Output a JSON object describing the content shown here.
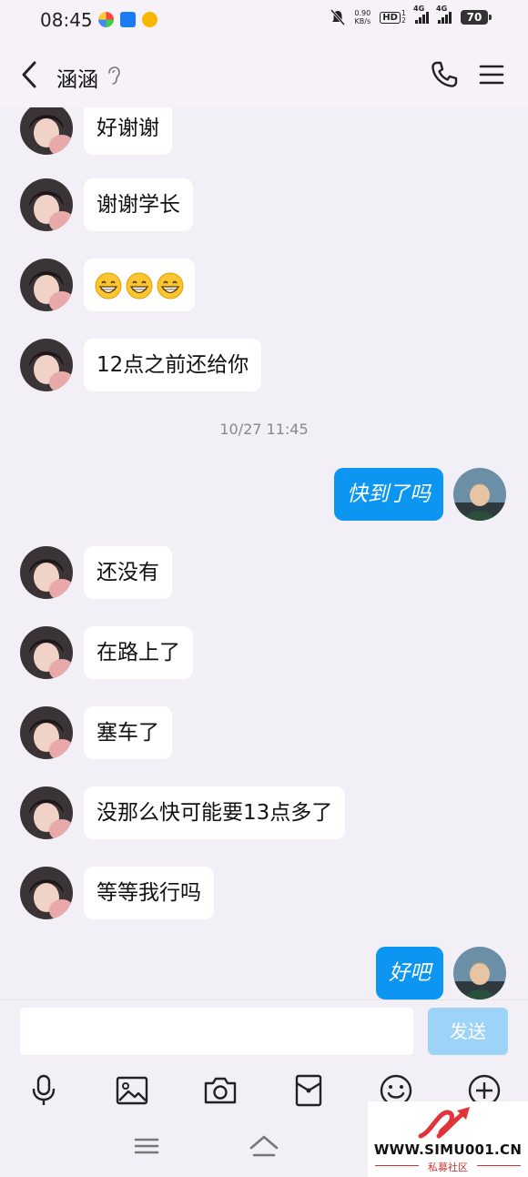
{
  "status_bar": {
    "time": "08:45",
    "net_speed": "0.90",
    "net_unit": "KB/s",
    "hd_label": "HD",
    "hd_sub1": "1",
    "hd_sub2": "2",
    "sim1_type": "4G",
    "sim2_type": "4G",
    "battery": "70"
  },
  "header": {
    "back_icon": "chevron-left",
    "title": "涵涵",
    "ear_icon": "ear",
    "phone_icon": "phone",
    "menu_icon": "hamburger"
  },
  "messages": [
    {
      "side": "left",
      "text": "好谢谢"
    },
    {
      "side": "left",
      "text": "谢谢学长"
    },
    {
      "side": "left",
      "emoji": "grinning-face",
      "emoji_count": 3
    },
    {
      "side": "left",
      "text": "12点之前还给你"
    },
    {
      "type": "timestamp",
      "text": "10/27 11:45"
    },
    {
      "side": "right",
      "text": "快到了吗"
    },
    {
      "side": "left",
      "text": "还没有"
    },
    {
      "side": "left",
      "text": "在路上了"
    },
    {
      "side": "left",
      "text": "塞车了"
    },
    {
      "side": "left",
      "text": "没那么快可能要13点多了"
    },
    {
      "side": "left",
      "text": "等等我行吗"
    },
    {
      "side": "right",
      "text": "好吧"
    }
  ],
  "input": {
    "value": "",
    "send_label": "发送"
  },
  "toolbar": [
    "microphone-icon",
    "image-icon",
    "camera-icon",
    "red-packet-icon",
    "emoji-icon",
    "plus-icon"
  ],
  "navbar": [
    "menu-icon",
    "home-icon"
  ],
  "watermark": {
    "site": "WWW.SIMU001.CN",
    "sub": "私募社区"
  },
  "colors": {
    "background": "#f2eff7",
    "bubble_left": "#ffffff",
    "bubble_right": "#0c96f2",
    "send_button": "#9ed3f8"
  }
}
